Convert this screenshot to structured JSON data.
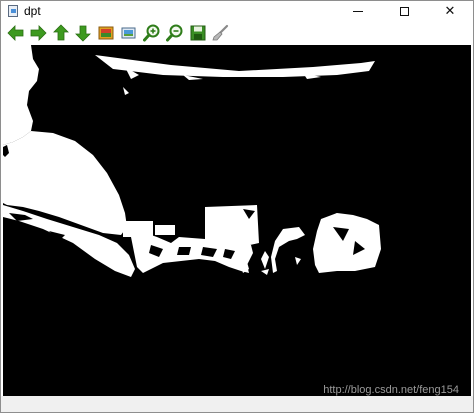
{
  "window": {
    "title": "dpt",
    "controls": {
      "minimize": "minimize",
      "maximize": "maximize",
      "close": "✕"
    }
  },
  "toolbar": {
    "tools": [
      {
        "name": "pan-left",
        "icon": "arrow-left-icon"
      },
      {
        "name": "pan-right",
        "icon": "arrow-right-icon"
      },
      {
        "name": "pan-up",
        "icon": "arrow-up-icon"
      },
      {
        "name": "pan-down",
        "icon": "arrow-down-icon"
      },
      {
        "name": "save-image",
        "icon": "image-icon"
      },
      {
        "name": "properties",
        "icon": "image-properties-icon"
      },
      {
        "name": "zoom-in",
        "icon": "zoom-in-icon"
      },
      {
        "name": "zoom-out",
        "icon": "zoom-out-icon"
      },
      {
        "name": "save",
        "icon": "floppy-disk-icon"
      },
      {
        "name": "settings",
        "icon": "brush-icon"
      }
    ]
  },
  "image_view": {
    "content": "binary thresholded image",
    "watermark": "http://blog.csdn.net/feng154"
  }
}
